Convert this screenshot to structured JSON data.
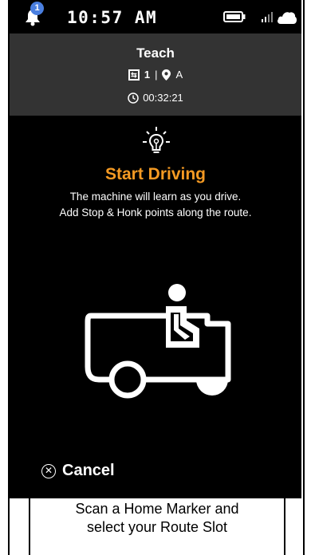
{
  "status_bar": {
    "notification_count": "1",
    "time": "10:57 AM",
    "icons": [
      "bell-icon",
      "battery-icon",
      "signal-icon",
      "cloud-icon"
    ]
  },
  "header": {
    "title": "Teach",
    "slot_number": "1",
    "separator": "|",
    "home_marker": "A",
    "timer": "00:32:21"
  },
  "main": {
    "title": "Start Driving",
    "description_line1": "The machine will learn as you drive.",
    "description_line2": "Add Stop & Honk points along the route.",
    "cancel_label": "Cancel"
  },
  "footer": {
    "line1": "Scan a Home Marker and",
    "line2": "select your Route Slot"
  },
  "colors": {
    "accent": "#f59a23",
    "header_bg": "#333333",
    "main_bg": "#000000",
    "badge": "#4a7fe0"
  }
}
